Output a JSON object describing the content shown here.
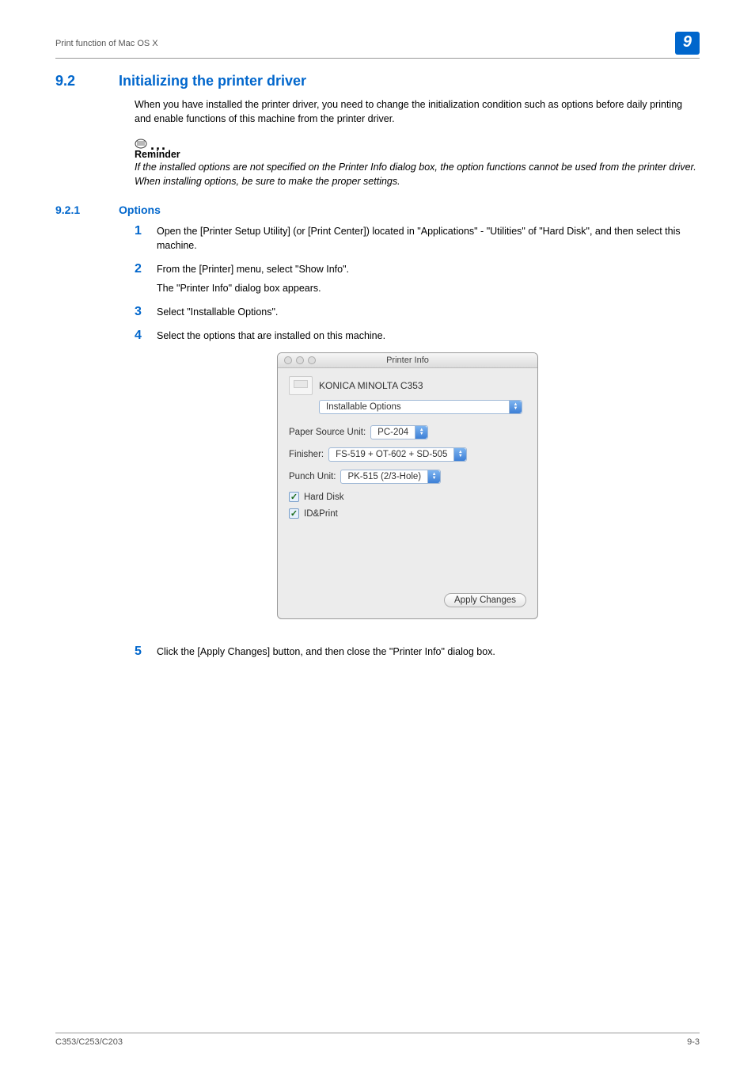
{
  "header": {
    "breadcrumb": "Print function of Mac OS X",
    "chapter": "9"
  },
  "section": {
    "number": "9.2",
    "title": "Initializing the printer driver",
    "intro": "When you have installed the printer driver, you need to change the initialization condition such as options before daily printing and enable functions of this machine from the printer driver."
  },
  "reminder": {
    "label": "Reminder",
    "text": "If the installed options are not specified on the Printer Info dialog box, the option functions cannot be used from the printer driver. When installing options, be sure to make the proper settings."
  },
  "subsection": {
    "number": "9.2.1",
    "title": "Options"
  },
  "steps": {
    "s1": "Open the [Printer Setup Utility] (or [Print Center]) located in \"Applications\" - \"Utilities\" of \"Hard Disk\", and then select this machine.",
    "s2": "From the [Printer] menu, select \"Show Info\".",
    "s2sub": "The \"Printer Info\" dialog box appears.",
    "s3": "Select \"Installable Options\".",
    "s4": "Select the options that are installed on this machine.",
    "s5": "Click the [Apply Changes] button, and then close the \"Printer Info\" dialog box."
  },
  "dialog": {
    "title": "Printer Info",
    "printer_name": "KONICA MINOLTA C353",
    "pane": "Installable Options",
    "paper_source_label": "Paper Source Unit:",
    "paper_source_value": "PC-204",
    "finisher_label": "Finisher:",
    "finisher_value": "FS-519 + OT-602 + SD-505",
    "punch_label": "Punch Unit:",
    "punch_value": "PK-515 (2/3-Hole)",
    "hard_disk": "Hard Disk",
    "id_print": "ID&Print",
    "apply_button": "Apply Changes"
  },
  "footer": {
    "left": "C353/C253/C203",
    "right": "9-3"
  }
}
